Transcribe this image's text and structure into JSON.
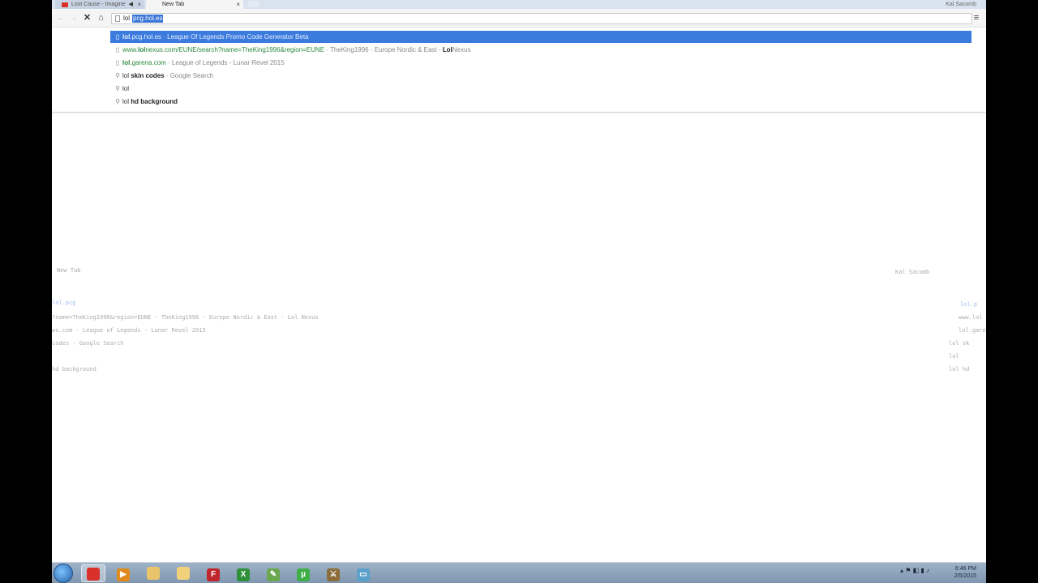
{
  "browser": {
    "tabs": [
      {
        "title": "Lost Cause - Imagine",
        "favicon_color": "#d9302a",
        "active": false
      },
      {
        "title": "New Tab",
        "favicon_color": "#ffffff",
        "active": true
      }
    ],
    "user_label": "Kal Sacomb",
    "omnibox": {
      "typed": "lol",
      "autocomplete": "pcg.hol.es"
    }
  },
  "suggestions": [
    {
      "icon": "page-icon",
      "url_bold": "lol",
      "url_rest": ".pcg.hol.es",
      "sep": " - ",
      "desc": "League Of Legends Promo Code Generator Beta",
      "selected": true
    },
    {
      "icon": "page-icon",
      "url_pre": "www.",
      "url_bold": "lol",
      "url_rest": "nexus.com/EUNE/search?name=TheKing1996&region=EUNE",
      "sep": " - ",
      "desc": "TheKing1996 - Europe Nordic & East - ",
      "desc_bold": "Lol",
      "desc_after": "Nexus",
      "selected": false
    },
    {
      "icon": "page-icon",
      "url_bold": "lol",
      "url_rest": ".garena.com",
      "sep": " - ",
      "desc": "League of Legends - Lunar Revel 2015",
      "selected": false
    },
    {
      "icon": "search-icon",
      "plain": "lol ",
      "bold": "skin codes",
      "sep": " - ",
      "desc": "Google Search",
      "selected": false
    },
    {
      "icon": "search-icon",
      "plain": "lol",
      "selected": false
    },
    {
      "icon": "search-icon",
      "plain": "lol ",
      "bold": "hd background",
      "selected": false
    }
  ],
  "ghost": {
    "line1": "New Tab",
    "line2": "?name=TheKing1996&region=EUNE - TheKing1996 - Europe Nordic & East - Lol Nexus",
    "line3": "ws.com - League of Legends - Lunar Revel 2015",
    "line4": "codes - Google Search",
    "line5": "hd background",
    "right1": "Kal Sacomb",
    "right2": "www.lol",
    "right3": "lol.gare",
    "right4": "lol sk",
    "right5": "lol",
    "right6": "lol hd"
  },
  "taskbar": {
    "apps": [
      {
        "name": "chrome",
        "glyph": "",
        "color": "#d9302a",
        "active": true
      },
      {
        "name": "media-player",
        "glyph": "▶",
        "color": "#e08a1e",
        "active": false
      },
      {
        "name": "file-explorer",
        "glyph": "",
        "color": "#e9c46a",
        "active": false
      },
      {
        "name": "folder",
        "glyph": "",
        "color": "#f0d078",
        "active": false
      },
      {
        "name": "filezilla",
        "glyph": "F",
        "color": "#c0262d",
        "active": false
      },
      {
        "name": "spreadsheet",
        "glyph": "X",
        "color": "#2f8f3a",
        "active": false
      },
      {
        "name": "notepad-plus",
        "glyph": "✎",
        "color": "#6aa84f",
        "active": false
      },
      {
        "name": "utorrent",
        "glyph": "µ",
        "color": "#3fae49",
        "active": false
      },
      {
        "name": "game-client",
        "glyph": "⚔",
        "color": "#8a6d3b",
        "active": false
      },
      {
        "name": "app-window",
        "glyph": "▭",
        "color": "#5aa0c8",
        "active": false
      }
    ],
    "clock_time": "6:46 PM",
    "clock_date": "2/5/2015"
  }
}
